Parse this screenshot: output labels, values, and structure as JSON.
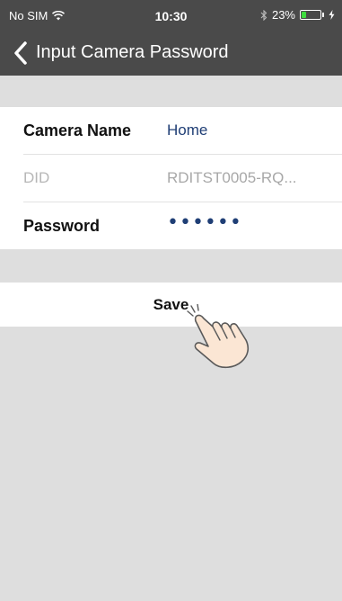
{
  "status_bar": {
    "carrier": "No SIM",
    "time": "10:30",
    "battery_percent": "23%",
    "battery_level": 0.23,
    "icons": [
      "wifi-icon",
      "bluetooth-icon",
      "battery-icon",
      "charging-bolt-icon"
    ]
  },
  "nav": {
    "title": "Input Camera Password",
    "back_icon": "chevron-left-icon"
  },
  "form": {
    "rows": [
      {
        "label": "Camera Name",
        "value": "Home"
      },
      {
        "label": "DID",
        "value": "RDITST0005-RQ..."
      },
      {
        "label": "Password",
        "value": "••••••"
      }
    ]
  },
  "actions": {
    "save_label": "Save"
  },
  "overlay": {
    "icon": "pointing-hand-icon"
  },
  "colors": {
    "nav_bg": "#4a4a4a",
    "page_bg": "#dedede",
    "value_text": "#1f3e75",
    "battery": "#3ddc3d"
  }
}
